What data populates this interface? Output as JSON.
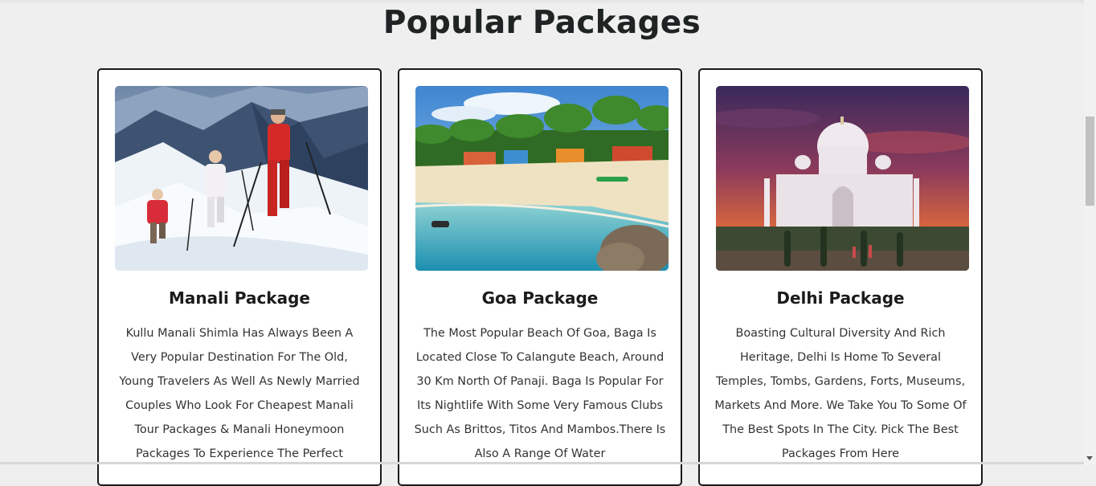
{
  "section": {
    "title": "Popular Packages"
  },
  "packages": [
    {
      "title": "Manali Package",
      "description": "Kullu Manali Shimla Has Always Been A Very Popular Destination For The Old, Young Travelers As Well As Newly Married Couples Who Look For Cheapest Manali Tour Packages & Manali Honeymoon Packages To Experience The Perfect"
    },
    {
      "title": "Goa Package",
      "description": "The Most Popular Beach Of Goa, Baga Is Located Close To Calangute Beach, Around 30 Km North Of Panaji. Baga Is Popular For Its Nightlife With Some Very Famous Clubs Such As Brittos, Titos And Mambos.There Is Also A Range Of Water"
    },
    {
      "title": "Delhi Package",
      "description": "Boasting Cultural Diversity And Rich Heritage, Delhi Is Home To Several Temples, Tombs, Gardens, Forts, Museums, Markets And More. We Take You To Some Of The Best Spots In The City. Pick The Best Packages From Here"
    }
  ],
  "icons": {
    "scroll_down": "chevron-down-icon"
  }
}
